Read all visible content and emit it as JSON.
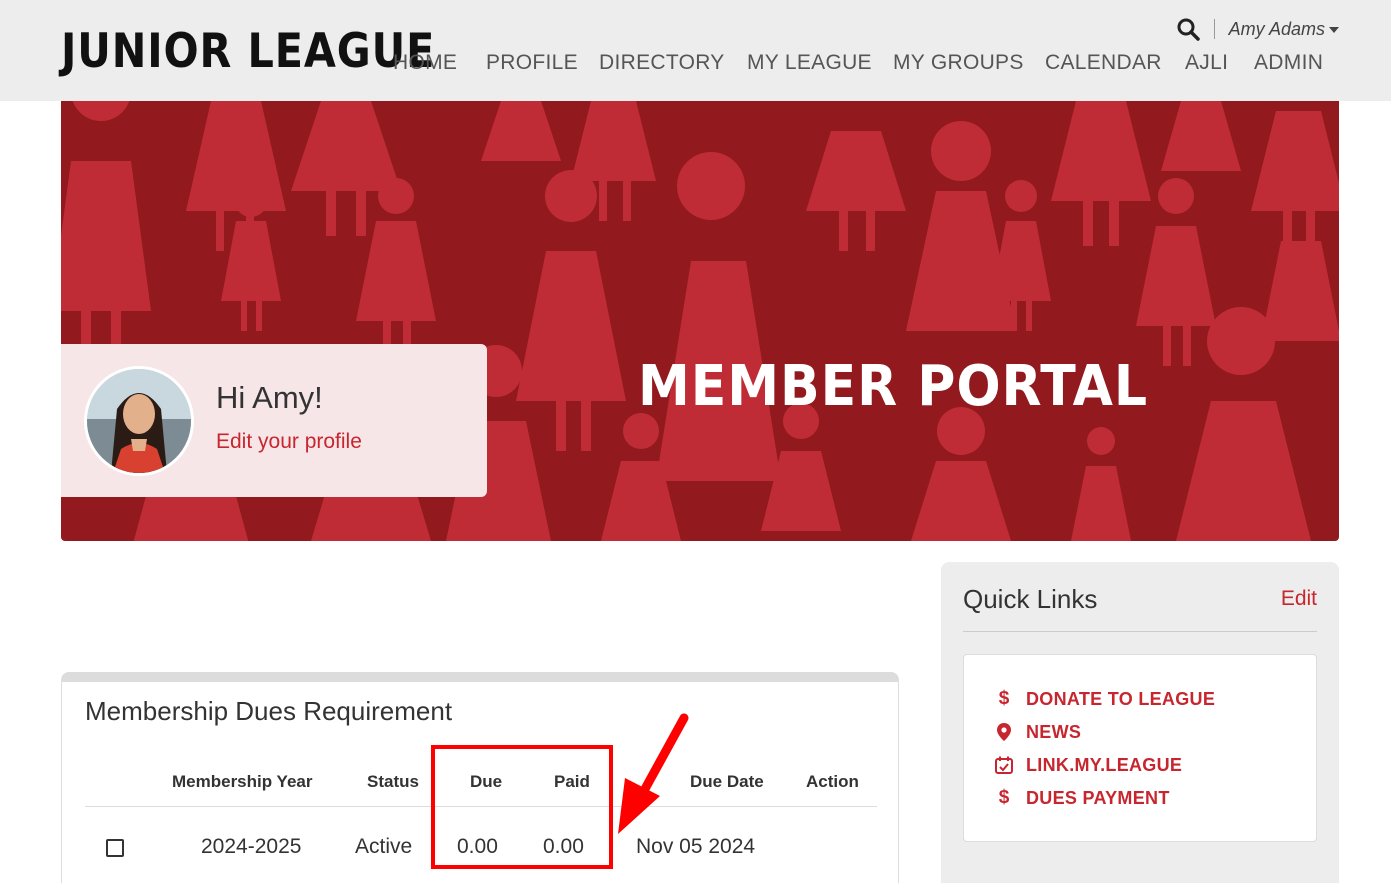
{
  "header": {
    "logo": "JUNIOR LEAGUE",
    "nav": [
      "HOME",
      "PROFILE",
      "DIRECTORY",
      "MY LEAGUE",
      "MY GROUPS",
      "CALENDAR",
      "AJLI",
      "ADMIN"
    ],
    "user_name": "Amy Adams"
  },
  "banner": {
    "title": "MEMBER PORTAL",
    "greeting": "Hi Amy!",
    "edit_profile": "Edit your profile",
    "colors": {
      "banner": "#921a1f",
      "figure": "#c8303a",
      "accent": "#c8262f"
    }
  },
  "dues": {
    "title": "Membership Dues Requirement",
    "columns": [
      "Membership Year",
      "Status",
      "Due",
      "Paid",
      "Due Date",
      "Action"
    ],
    "rows": [
      {
        "year": "2024-2025",
        "status": "Active",
        "due": "0.00",
        "paid": "0.00",
        "due_date": "Nov 05 2024",
        "action": ""
      }
    ]
  },
  "quick_links": {
    "title": "Quick Links",
    "edit": "Edit",
    "items": [
      {
        "icon": "dollar-icon",
        "label": "DONATE TO LEAGUE"
      },
      {
        "icon": "map-pin-icon",
        "label": "NEWS"
      },
      {
        "icon": "calendar-check-icon",
        "label": "LINK.MY.LEAGUE"
      },
      {
        "icon": "dollar-icon",
        "label": "DUES PAYMENT"
      }
    ]
  }
}
